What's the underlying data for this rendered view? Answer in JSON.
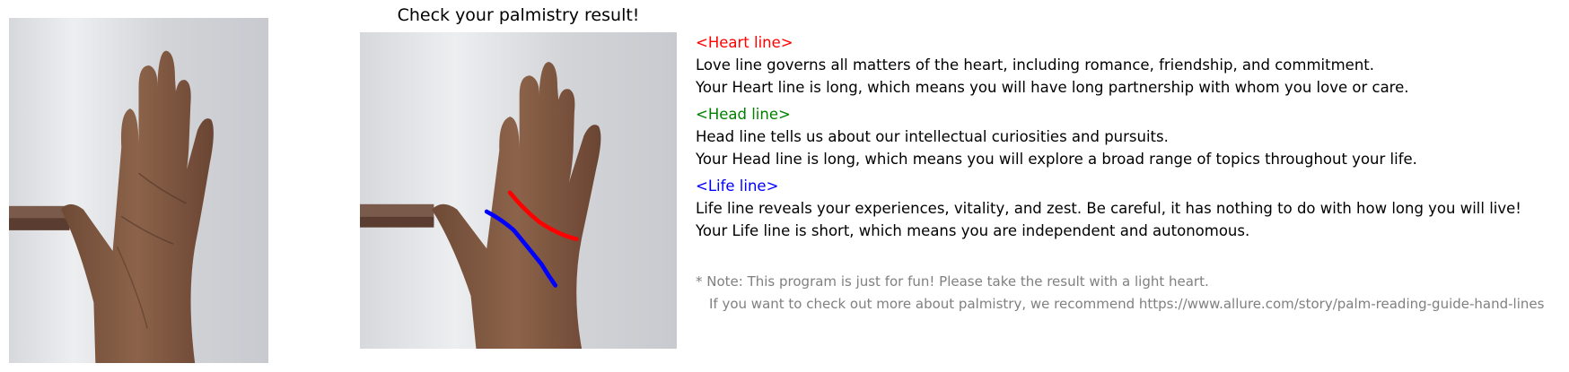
{
  "title": "Check your palmistry result!",
  "colors": {
    "heart": "#ff0000",
    "head": "#008000",
    "life": "#0000ff",
    "note": "#808080"
  },
  "heart": {
    "heading": "<Heart line>",
    "desc": "Love line governs all matters of the heart, including romance, friendship, and commitment.",
    "result": "Your Heart line is long, which means you will have long partnership with whom you love or care."
  },
  "head": {
    "heading": "<Head line>",
    "desc": "Head line tells us about our intellectual curiosities and pursuits.",
    "result": "Your Head line is long, which means you will explore a broad range of topics throughout your life."
  },
  "life": {
    "heading": "<Life line>",
    "desc": "Life line reveals your experiences, vitality, and zest. Be careful, it has nothing to do with how long you will live!",
    "result": "Your Life line is short, which means you are independent and autonomous."
  },
  "note": {
    "line1": "* Note: This program is just for fun! Please take the result with a light heart.",
    "line2": "If you want to check out more about palmistry, we recommend https://www.allure.com/story/palm-reading-guide-hand-lines"
  }
}
